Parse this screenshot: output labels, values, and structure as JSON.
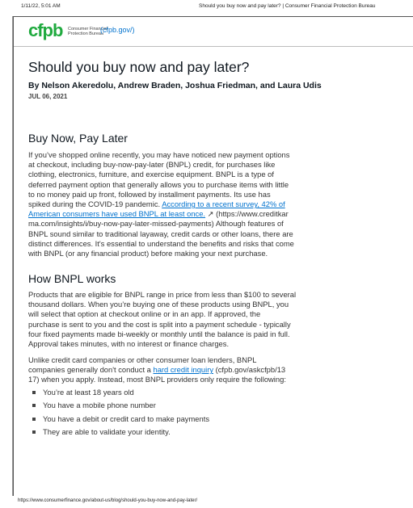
{
  "browser": {
    "timestamp": "1/11/22, 5:01 AM",
    "page_title": "Should you buy now and pay later? | Consumer Financial Protection Bureau",
    "footer_url": "https://www.consumerfinance.gov/about-us/blog/should-you-buy-now-and-pay-later/"
  },
  "header": {
    "logo_text": "cfpb",
    "org_name_line1": "Consumer Financial",
    "org_name_line2": "Protection Bureau",
    "org_url": "(cfpb.gov/)"
  },
  "article": {
    "title": "Should you buy now and pay later?",
    "byline": "By Nelson Akeredolu, Andrew Braden, Joshua Friedman, and Laura Udis",
    "date": "JUL 06, 2021",
    "section1": {
      "heading": "Buy Now, Pay Later",
      "lines": [
        "If you’ve shopped online recently, you may have noticed new payment options",
        "at checkout, including buy-now-pay-later (BNPL) credit, for purchases like",
        "clothing, electronics, furniture, and exercise equipment. BNPL is a type of",
        "deferred payment option that generally allows you to purchase items with little",
        "to no money paid up front, followed by installment payments. Its use has"
      ],
      "line6_text": "spiked during the COVID-19 pandemic. ",
      "line6_link": "According to a recent survey, 42% of",
      "line7_link": "American consumers have used BNPL at least once.",
      "line7_icon": "↗",
      "line7_text": " (https://www.creditkar",
      "lines_after": [
        "ma.com/insights/i/buy-now-pay-later-missed-payments) Although features of",
        "BNPL sound similar to traditional layaway, credit cards or other loans, there are",
        "distinct differences. It's essential to understand the benefits and risks that come",
        "with BNPL (or any financial product) before making your next purchase."
      ]
    },
    "section2": {
      "heading": "How BNPL works",
      "para1": [
        "Products that are eligible for BNPL range in price from less than $100 to several",
        "thousand dollars. When you’re buying one of these products using BNPL, you",
        "will select that option at checkout online or in an app. If approved, the",
        "purchase is sent to you and the cost is split into a payment schedule - typically",
        "four fixed payments made bi-weekly or monthly until the balance is paid in full.",
        "Approval takes minutes, with no interest or finance charges."
      ],
      "para2_line1": "Unlike credit card companies or other consumer loan lenders, BNPL",
      "para2_line2_text": "companies generally don't conduct a ",
      "para2_line2_link": "hard credit inquiry",
      "para2_line2_tail": " (cfpb.gov/askcfpb/13",
      "para2_line3": "17) when you apply. Instead, most BNPL providers only require the following:",
      "requirements": [
        "You’re at least 18 years old",
        "You have a mobile phone number",
        "You have a debit or credit card to make payments",
        "They are able to validate your identity."
      ]
    }
  },
  "colors": {
    "brand_green": "#20aa3f",
    "link_blue": "#0072ce",
    "text": "#333333"
  }
}
